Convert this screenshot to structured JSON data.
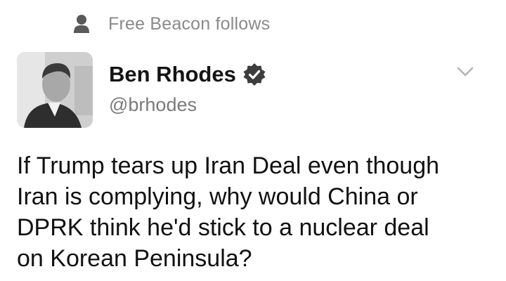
{
  "context": {
    "icon": "person-icon",
    "text": "Free Beacon follows"
  },
  "author": {
    "avatar_icon": "avatar",
    "display_name": "Ben Rhodes",
    "verified_icon": "verified-badge-icon",
    "handle": "@brhodes"
  },
  "menu": {
    "icon": "chevron-down-icon"
  },
  "tweet": {
    "text": "If Trump tears up Iran Deal even though\nIran is complying, why would China or\nDPRK think he'd stick to a nuclear deal\non Korean Peninsula?"
  },
  "colors": {
    "context_text": "#8a8a8a",
    "verified_badge": "#3d3d3d",
    "handle_text": "#7a7a7a"
  }
}
